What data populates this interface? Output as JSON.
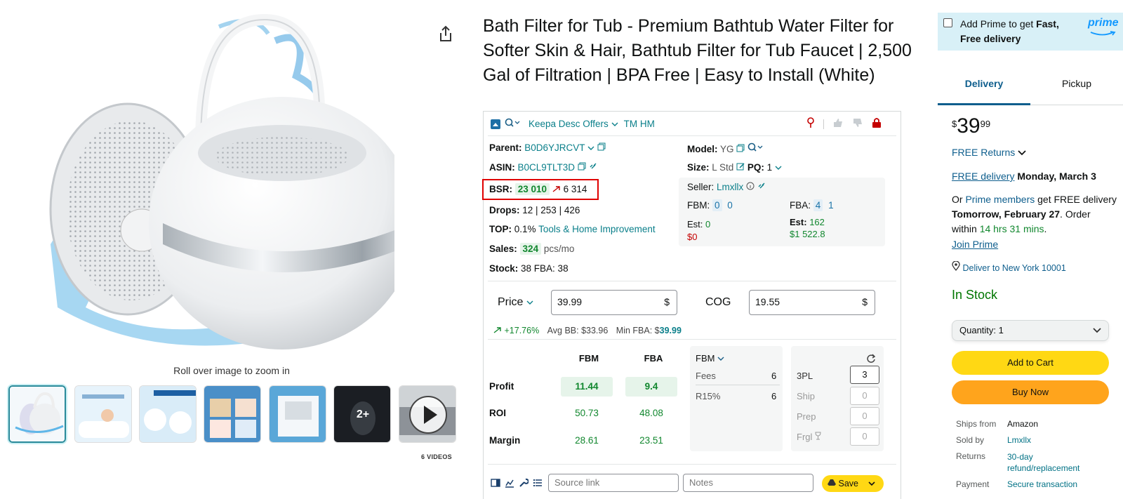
{
  "gallery": {
    "zoom_hint": "Roll over image to zoom in",
    "more_count": "2+",
    "videos_label": "6 VIDEOS"
  },
  "product": {
    "title": "Bath Filter for Tub - Premium Bathtub Water Filter for Softer Skin & Hair, Bathtub Filter for Tub Faucet | 2,500 Gal of Filtration | BPA Free | Easy to Install (White)"
  },
  "keepa": {
    "toolbar": {
      "menu_label": "Keepa Desc Offers",
      "tm": "TM HM"
    },
    "parent_label": "Parent:",
    "parent_value": "B0D6YJRCVT",
    "asin_label": "ASIN:",
    "asin_value": "B0CL9TLT3D",
    "bsr_label": "BSR:",
    "bsr_value": "23 010",
    "bsr_trend": "6 314",
    "drops_label": "Drops:",
    "drops_value": "12 | 253 | 426",
    "top_label": "TOP:",
    "top_pct": "0.1%",
    "top_category": "Tools & Home Improvement",
    "sales_label": "Sales:",
    "sales_value": "324",
    "sales_unit": "pcs/mo",
    "stock_label": "Stock:",
    "stock_value": "38 FBA: 38",
    "model_label": "Model:",
    "model_value": "YG",
    "size_label": "Size:",
    "size_value": "L Std",
    "pq_label": "PQ:",
    "pq_value": "1",
    "seller_label": "Seller:",
    "seller_value": "Lmxllx",
    "fbm_label": "FBM:",
    "fbm_a": "0",
    "fbm_b": "0",
    "fba_label": "FBA:",
    "fba_a": "4",
    "fba_b": "1",
    "est_left_label": "Est:",
    "est_left_value": "0",
    "est_left_money": "$0",
    "est_right_label": "Est:",
    "est_right_value": "162",
    "est_right_money": "$1 522.8",
    "price_label": "Price",
    "price_value": "39.99",
    "currency": "$",
    "cog_label": "COG",
    "cog_value": "19.55",
    "change_pct": "+17.76%",
    "avg_bb": "Avg BB: $33.96",
    "min_fba_label": "Min FBA: $",
    "min_fba_value": "39.99",
    "calc": {
      "col_fbm": "FBM",
      "col_fba": "FBA",
      "profit_label": "Profit",
      "profit_fbm": "11.44",
      "profit_fba": "9.4",
      "roi_label": "ROI",
      "roi_fbm": "50.73",
      "roi_fba": "48.08",
      "margin_label": "Margin",
      "margin_fbm": "28.61",
      "margin_fba": "23.51"
    },
    "fees": {
      "mode": "FBM",
      "fees_label": "Fees",
      "fees_value": "6",
      "r_label": "R15%",
      "r_value": "6"
    },
    "extras": {
      "pl_label": "3PL",
      "pl_value": "3",
      "ship_label": "Ship",
      "ship_value": "0",
      "prep_label": "Prep",
      "prep_value": "0",
      "frgl_label": "Frgl",
      "frgl_value": "0"
    },
    "bottom": {
      "source_placeholder": "Source link",
      "notes_placeholder": "Notes",
      "save_label": "Save"
    }
  },
  "buybox": {
    "prime_text_1": "Add Prime to get ",
    "prime_text_bold": "Fast, Free delivery",
    "prime_logo": "prime",
    "tab_delivery": "Delivery",
    "tab_pickup": "Pickup",
    "price_symbol": "$",
    "price_whole": "39",
    "price_fraction": "99",
    "free_returns": "FREE Returns",
    "free_delivery_link": "FREE delivery",
    "free_delivery_date": "Monday, March 3",
    "or_text": "Or ",
    "prime_members": "Prime members",
    "get_free": " get FREE delivery ",
    "fast_date": "Tomorrow, February 27",
    "order_within": ". Order within ",
    "countdown": "14 hrs 31 mins",
    "period": ".",
    "join_prime": "Join Prime",
    "deliver_to": "Deliver to New York 10001",
    "stock": "In Stock",
    "quantity": "Quantity: 1",
    "add_to_cart": "Add to Cart",
    "buy_now": "Buy Now",
    "ships_from_label": "Ships from",
    "ships_from_value": "Amazon",
    "sold_by_label": "Sold by",
    "sold_by_value": "Lmxllx",
    "returns_label": "Returns",
    "returns_value": "30-day refund/replacement",
    "payment_label": "Payment",
    "payment_value": "Secure transaction"
  },
  "colors": {
    "teal": "#007185",
    "green": "#11872e",
    "red": "#c40000",
    "cart": "#ffd814",
    "buy": "#ffa41c",
    "save": "#ffd814"
  }
}
